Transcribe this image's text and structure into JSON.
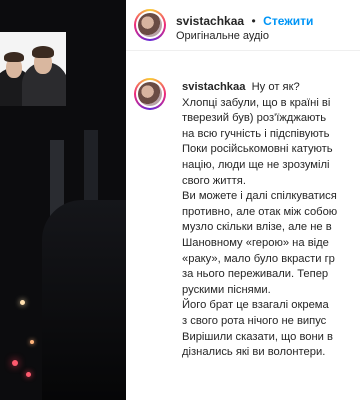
{
  "post": {
    "username": "svistachkaa",
    "separator": "•",
    "follow_label": "Стежити",
    "audio_label": "Оригінальне аудіо"
  },
  "caption": {
    "username": "svistachkaa",
    "first_line": "Ну от як?",
    "lines": [
      "Хлопці забули, що в країні ві",
      "тверезий був) роз'їжджають",
      "на всю гучність і підспівують",
      "Поки російськомовні катують",
      "націю, люди ще не зрозумілі",
      "свого життя.",
      "Ви можете і далі спілкуватися",
      "противно, але отак між собою",
      "музло скільки влізе, але не в",
      "Шановному «герою» на віде",
      "«раку», мало було вкрасти гр",
      "за нього переживали. Тепер",
      "рускими піснями.",
      "Його брат це взагалі окрема",
      "з свого рота нічого не випус",
      "Вирішили сказати, що вони в",
      "дізнались які ви волонтери."
    ]
  }
}
